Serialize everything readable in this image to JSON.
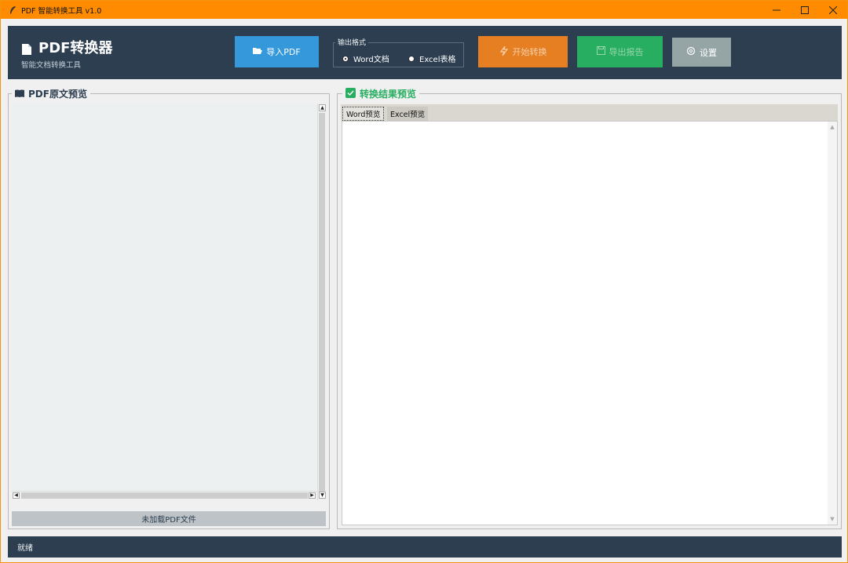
{
  "window": {
    "title": "PDF 智能转换工具 v1.0",
    "minimize": "—",
    "maximize": "☐",
    "close": "✕"
  },
  "header": {
    "app_title": "PDF转换器",
    "app_subtitle": "智能文档转换工具",
    "import_label": "导入PDF",
    "convert_label": "开始转换",
    "export_label": "导出报告",
    "settings_label": "设置",
    "output_format": {
      "legend": "输出格式",
      "options": [
        "Word文档",
        "Excel表格"
      ],
      "selected": "Word文档"
    }
  },
  "left_panel": {
    "title": "PDF原文预览",
    "status": "未加载PDF文件"
  },
  "right_panel": {
    "title": "转换结果预览",
    "tabs": [
      "Word预览",
      "Excel预览"
    ],
    "active_tab": "Word预览"
  },
  "statusbar": {
    "text": "就绪"
  },
  "colors": {
    "titlebar": "#ff8c00",
    "header_bg": "#2c3e50",
    "import_btn": "#3498db",
    "convert_btn": "#e67e22",
    "export_btn": "#27ae60",
    "settings_btn": "#95a5a6",
    "result_title": "#27ae60"
  }
}
